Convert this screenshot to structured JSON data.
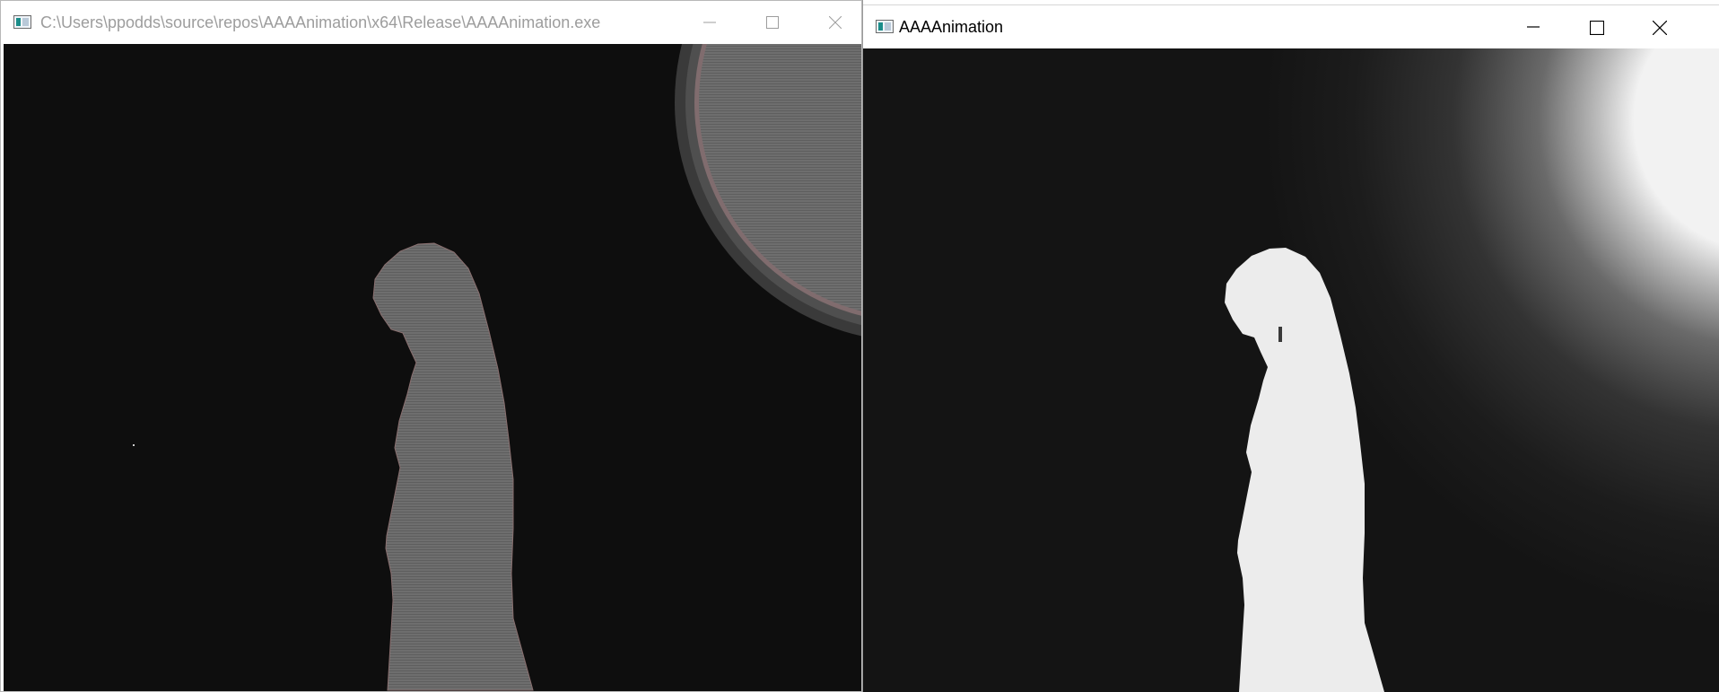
{
  "windows": {
    "left": {
      "title": "C:\\Users\\ppodds\\source\\repos\\AAAAnimation\\x64\\Release\\AAAAnimation.exe",
      "state": "inactive",
      "icons": {
        "app": "console-app-icon",
        "minimize": "minimize-icon",
        "maximize": "maximize-icon",
        "close": "close-icon"
      },
      "colors": {
        "title_text": "#9d9d9d",
        "background": "#0e0e0e",
        "silhouette": "#6e6e6e",
        "glow": "#7a7a7a"
      }
    },
    "right": {
      "title": "AAAAnimation",
      "state": "active",
      "icons": {
        "app": "app-window-icon",
        "minimize": "minimize-icon",
        "maximize": "maximize-icon",
        "close": "close-icon"
      },
      "colors": {
        "title_text": "#000000",
        "background": "#141414",
        "silhouette": "#ececec",
        "glow": "#f2f2f2"
      }
    }
  }
}
